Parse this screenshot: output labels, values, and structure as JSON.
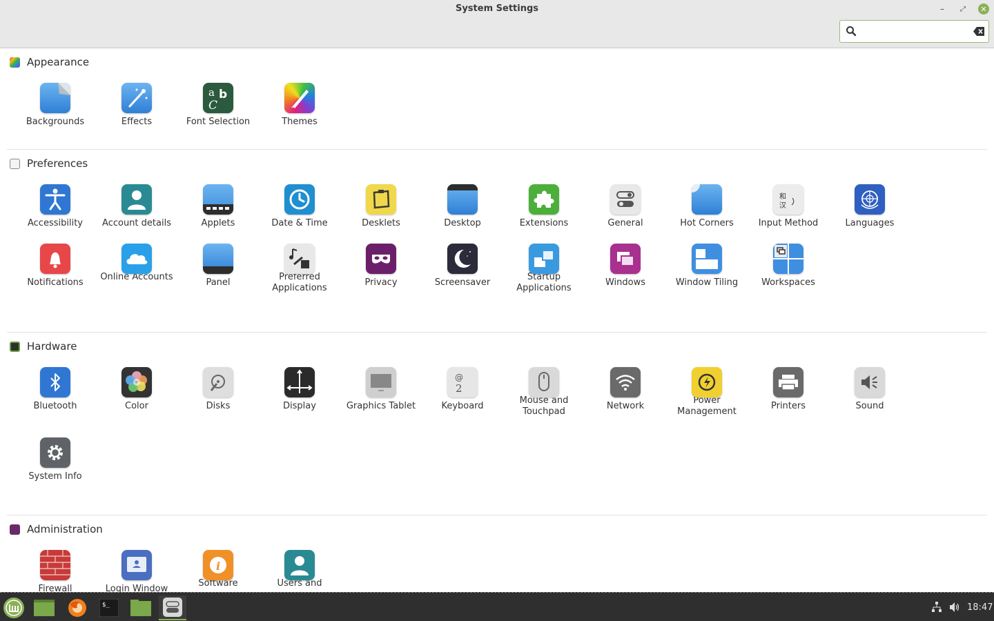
{
  "window": {
    "title": "System Settings",
    "search_placeholder": ""
  },
  "sections": {
    "appearance": {
      "title": "Appearance",
      "items": [
        "Backgrounds",
        "Effects",
        "Font Selection",
        "Themes"
      ]
    },
    "preferences": {
      "title": "Preferences",
      "items": [
        "Accessibility",
        "Account details",
        "Applets",
        "Date & Time",
        "Desklets",
        "Desktop",
        "Extensions",
        "General",
        "Hot Corners",
        "Input Method",
        "Languages",
        "Notifications",
        "Online Accounts",
        "Panel",
        "Preferred Applications",
        "Privacy",
        "Screensaver",
        "Startup Applications",
        "Windows",
        "Window Tiling",
        "Workspaces"
      ]
    },
    "hardware": {
      "title": "Hardware",
      "items": [
        "Bluetooth",
        "Color",
        "Disks",
        "Display",
        "Graphics Tablet",
        "Keyboard",
        "Mouse and Touchpad",
        "Network",
        "Power Management",
        "Printers",
        "Sound",
        "System Info"
      ]
    },
    "administration": {
      "title": "Administration",
      "items": [
        "Firewall",
        "Login Window",
        "Software",
        "Users and"
      ]
    }
  },
  "icon_glyphs": {
    "input_method_kanji_1": "和",
    "input_method_kanji_2": "汉",
    "keyboard_at": "@",
    "keyboard_two": "2"
  },
  "panel": {
    "clock": "18:47",
    "launchers": [
      "menu-icon",
      "show-desktop-icon",
      "firefox-icon",
      "terminal-icon",
      "files-icon",
      "system-settings-icon"
    ]
  },
  "colors": {
    "accent": "#8bb158",
    "panel_bg": "#2f2f2f",
    "header_bg": "#e8e8e8"
  }
}
